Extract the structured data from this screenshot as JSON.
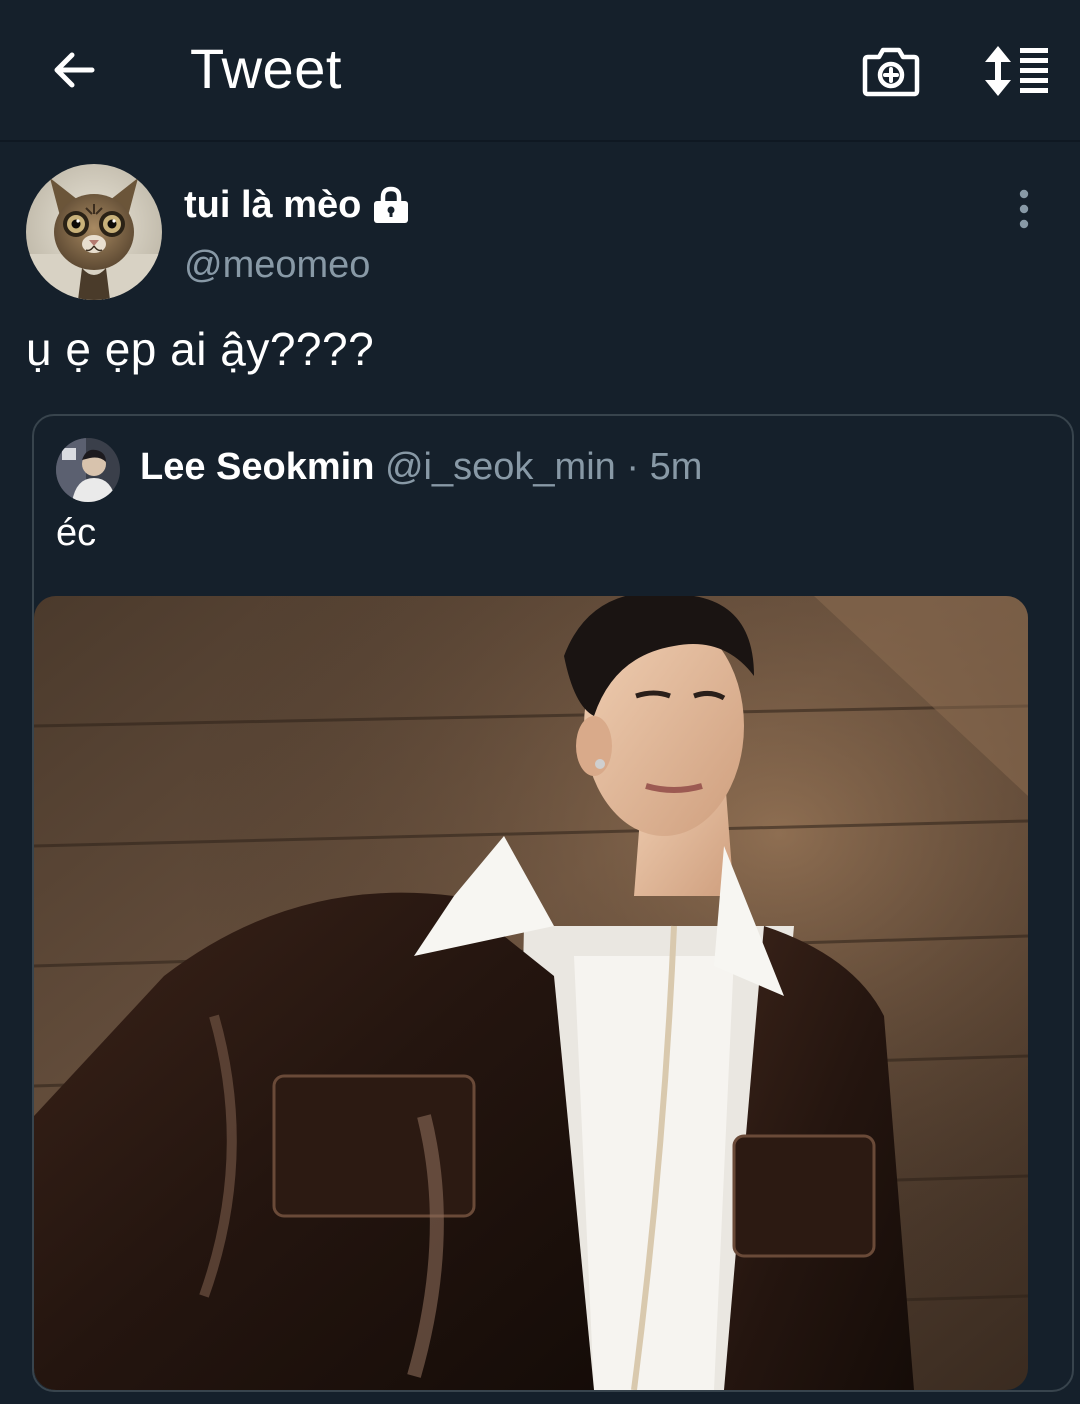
{
  "header": {
    "title": "Tweet",
    "back_icon": "arrow-left-icon",
    "camera_icon": "camera-plus-icon",
    "sort_icon": "sort-list-icon"
  },
  "author": {
    "name": "tui là mèo",
    "handle": "@meomeo",
    "protected_icon": "lock-icon",
    "avatar_icon": "cat-avatar"
  },
  "tweet": {
    "text": "ụ ẹ ẹp ai ậy????"
  },
  "quoted": {
    "name": "Lee Seokmin",
    "handle": "@i_seok_min",
    "separator": "·",
    "time": "5m",
    "text": "éc"
  },
  "colors": {
    "background": "#15202b",
    "secondary_text": "#8899a6",
    "border": "#38444d"
  }
}
